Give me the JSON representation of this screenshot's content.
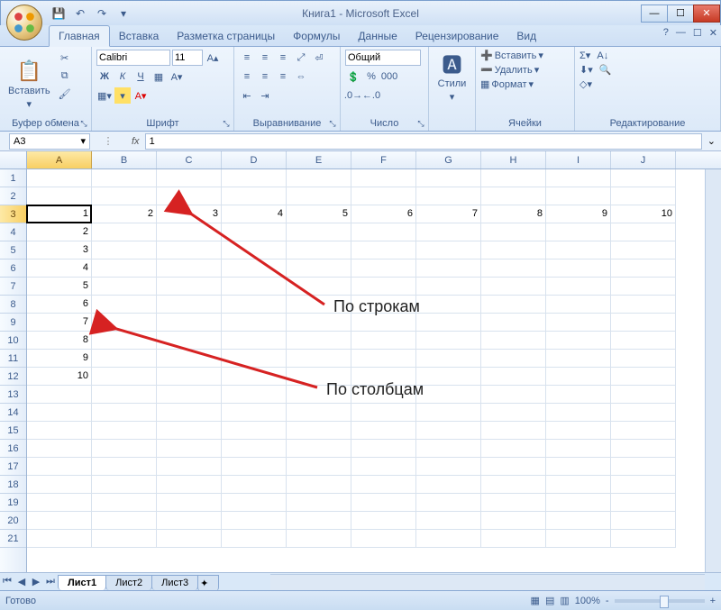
{
  "window": {
    "title": "Книга1 - Microsoft Excel"
  },
  "qat_tips": {
    "save": "save",
    "undo": "undo",
    "redo": "redo"
  },
  "tabs": {
    "home": "Главная",
    "insert": "Вставка",
    "layout": "Разметка страницы",
    "formulas": "Формулы",
    "data": "Данные",
    "review": "Рецензирование",
    "view": "Вид"
  },
  "ribbon": {
    "clipboard": {
      "paste": "Вставить",
      "label": "Буфер обмена"
    },
    "font": {
      "name": "Calibri",
      "size": "11",
      "label": "Шрифт",
      "bold": "Ж",
      "italic": "К",
      "underline": "Ч"
    },
    "align": {
      "label": "Выравнивание"
    },
    "number": {
      "format": "Общий",
      "label": "Число"
    },
    "styles": {
      "btn": "Стили"
    },
    "cells": {
      "insert": "Вставить",
      "delete": "Удалить",
      "format": "Формат",
      "label": "Ячейки"
    },
    "editing": {
      "label": "Редактирование"
    }
  },
  "formula_bar": {
    "name_box": "A3",
    "fx": "fx",
    "value": "1"
  },
  "columns": [
    "A",
    "B",
    "C",
    "D",
    "E",
    "F",
    "G",
    "H",
    "I",
    "J"
  ],
  "row_count": 21,
  "active_cell": {
    "row": 3,
    "col": 0
  },
  "data_row3": [
    "1",
    "2",
    "3",
    "4",
    "5",
    "6",
    "7",
    "8",
    "9",
    "10"
  ],
  "data_colA": {
    "4": "2",
    "5": "3",
    "6": "4",
    "7": "5",
    "8": "6",
    "9": "7",
    "10": "8",
    "11": "9",
    "12": "10"
  },
  "sheets": {
    "s1": "Лист1",
    "s2": "Лист2",
    "s3": "Лист3"
  },
  "status": {
    "ready": "Готово",
    "zoom": "100%"
  },
  "annotations": {
    "rows": "По строкам",
    "cols": "По столбцам"
  }
}
